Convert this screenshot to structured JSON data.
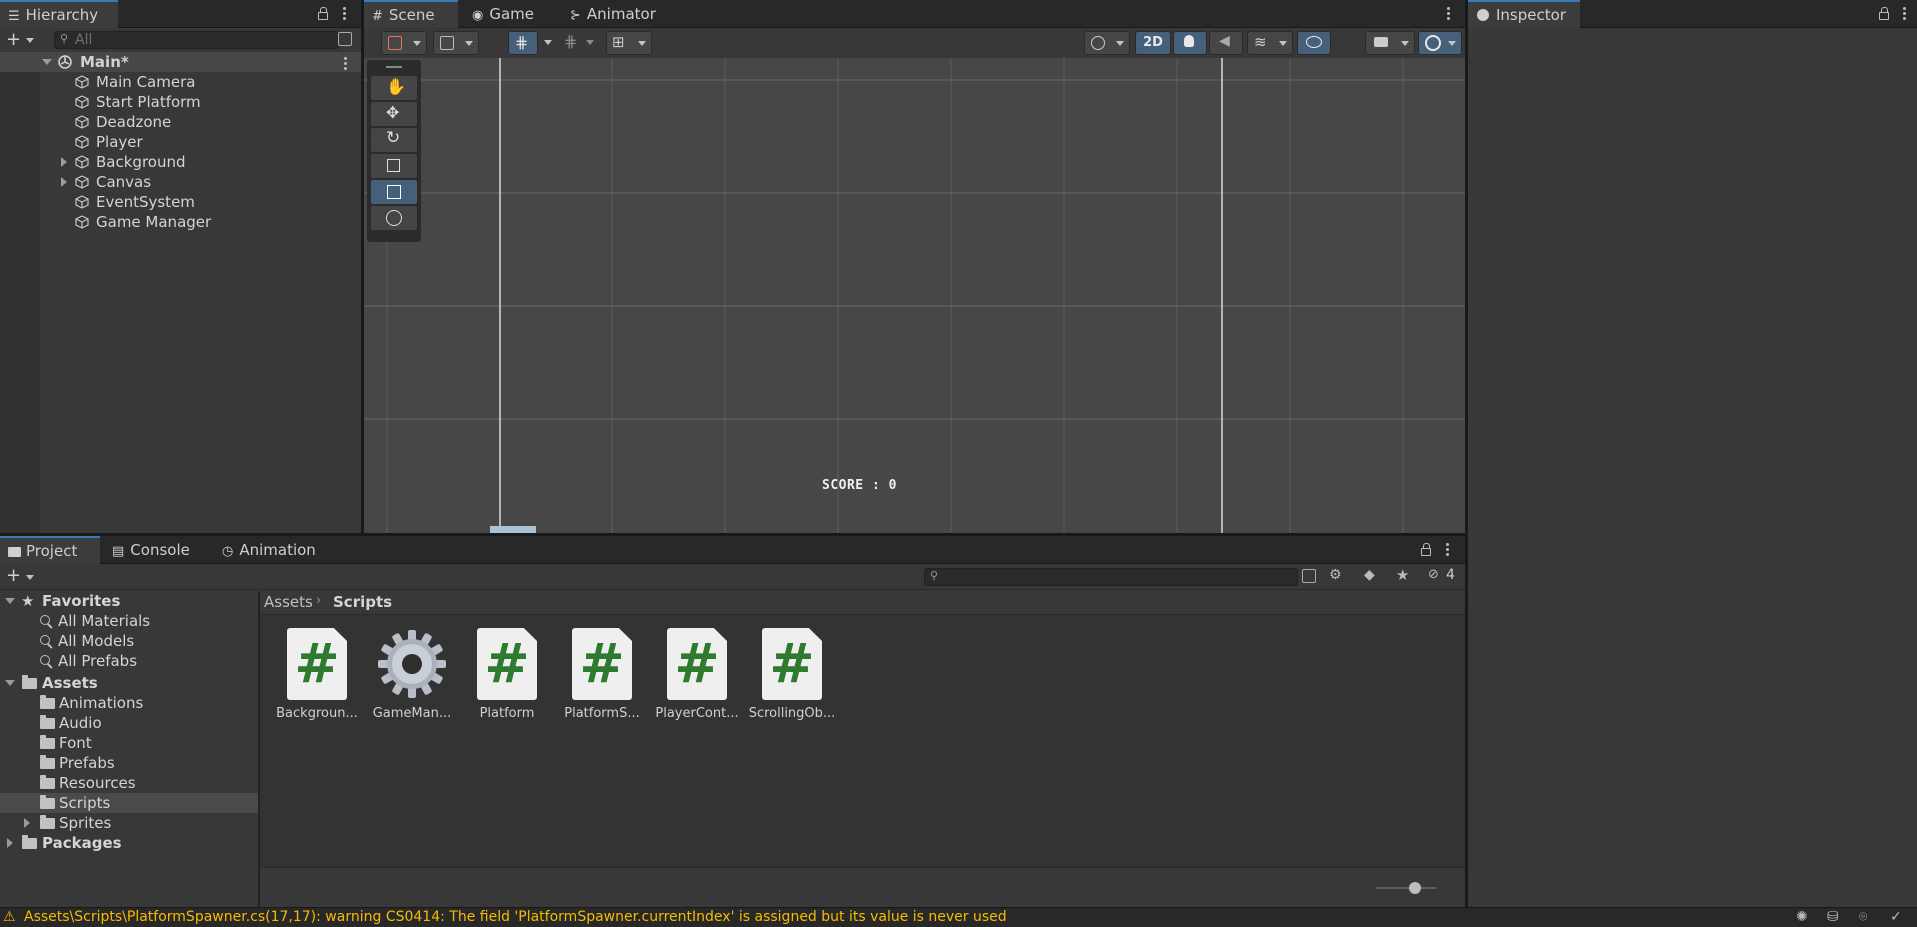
{
  "hierarchy": {
    "tab_label": "Hierarchy",
    "search_placeholder": "All",
    "scene_name": "Main*",
    "items": [
      {
        "label": "Main Camera",
        "expandable": false
      },
      {
        "label": "Start Platform",
        "expandable": false
      },
      {
        "label": "Deadzone",
        "expandable": false
      },
      {
        "label": "Player",
        "expandable": false
      },
      {
        "label": "Background",
        "expandable": true
      },
      {
        "label": "Canvas",
        "expandable": true
      },
      {
        "label": "EventSystem",
        "expandable": false
      },
      {
        "label": "Game Manager",
        "expandable": false
      }
    ]
  },
  "scene": {
    "tabs": [
      {
        "label": "Scene",
        "icon": "grid-icon"
      },
      {
        "label": "Game",
        "icon": "gamepad-icon"
      },
      {
        "label": "Animator",
        "icon": "animator-icon"
      }
    ],
    "mode_2d_label": "2D",
    "score_text": "SCORE : 0"
  },
  "inspector": {
    "tab_label": "Inspector"
  },
  "project": {
    "tabs": [
      {
        "label": "Project",
        "icon": "folder-icon"
      },
      {
        "label": "Console",
        "icon": "console-icon"
      },
      {
        "label": "Animation",
        "icon": "clock-icon"
      }
    ],
    "hidden_count": "4",
    "favorites_label": "Favorites",
    "favorites": [
      "All Materials",
      "All Models",
      "All Prefabs"
    ],
    "assets_label": "Assets",
    "asset_folders": [
      {
        "label": "Animations",
        "expandable": false
      },
      {
        "label": "Audio",
        "expandable": false
      },
      {
        "label": "Font",
        "expandable": false
      },
      {
        "label": "Prefabs",
        "expandable": false
      },
      {
        "label": "Resources",
        "expandable": false
      },
      {
        "label": "Scripts",
        "expandable": false,
        "selected": true
      },
      {
        "label": "Sprites",
        "expandable": true
      }
    ],
    "packages_label": "Packages",
    "breadcrumb": [
      "Assets",
      "Scripts"
    ],
    "files": [
      {
        "label": "Backgroun...",
        "type": "script"
      },
      {
        "label": "GameMan...",
        "type": "gear"
      },
      {
        "label": "Platform",
        "type": "script"
      },
      {
        "label": "PlatformS...",
        "type": "script"
      },
      {
        "label": "PlayerCont...",
        "type": "script"
      },
      {
        "label": "ScrollingOb...",
        "type": "script"
      }
    ],
    "script_glyph": "#"
  },
  "status": {
    "message": "Assets\\Scripts\\PlatformSpawner.cs(17,17): warning CS0414: The field 'PlatformSpawner.currentIndex' is assigned but its value is never used",
    "color": "#f4bc02"
  },
  "colors": {
    "accent": "#3a79bb",
    "toggle_on": "#46607c",
    "panel": "#383838",
    "scene_bg": "#474747"
  }
}
